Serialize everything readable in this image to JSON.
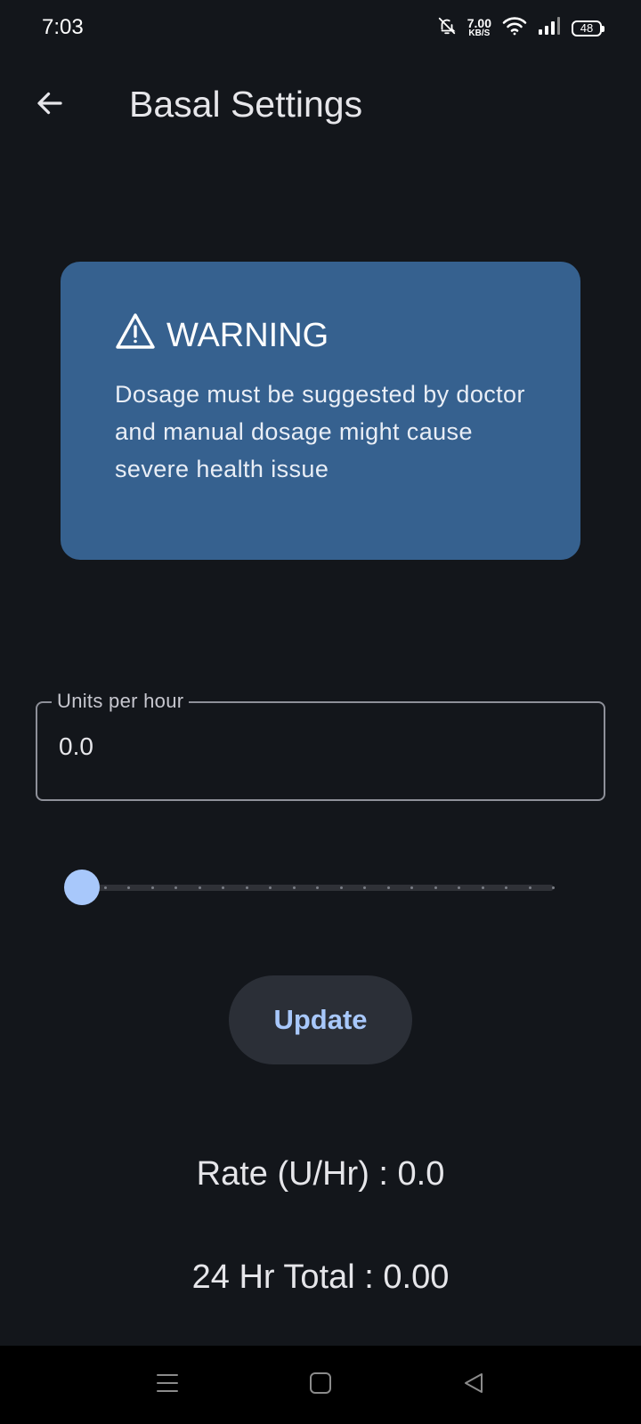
{
  "status_bar": {
    "time": "7:03",
    "net_speed_value": "7.00",
    "net_speed_unit": "KB/S",
    "battery_level": "48",
    "icons": [
      "bell-off-icon",
      "wifi-icon",
      "signal-icon",
      "battery-icon"
    ]
  },
  "app_bar": {
    "title": "Basal Settings",
    "back_icon": "arrow-back-icon"
  },
  "warning": {
    "title": "WARNING",
    "icon": "warning-icon",
    "message": "Dosage must be suggested by doctor and manual dosage might cause severe health issue",
    "background_color": "#36618f"
  },
  "units_field": {
    "label": "Units per hour",
    "value": "0.0"
  },
  "slider": {
    "value_fraction": 0.0,
    "divisions": 20,
    "thumb_color": "#a8c8fb"
  },
  "update_button": {
    "label": "Update"
  },
  "summary": {
    "rate_text": "Rate (U/Hr) : 0.0",
    "total_text": "24 Hr Total : 0.00"
  },
  "nav_bar": {
    "icons": [
      "menu-icon",
      "home-icon",
      "back-icon"
    ]
  },
  "colors": {
    "background": "#13161b",
    "accent": "#a8c8fb",
    "button_bg": "#2b2f37"
  }
}
